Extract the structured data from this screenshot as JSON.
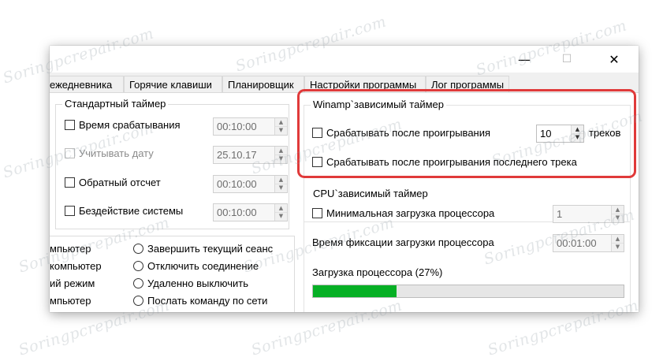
{
  "watermark": "Soringpcrepair.com",
  "window": {
    "minimize_glyph": "—",
    "maximize_glyph": "☐",
    "close_glyph": "✕"
  },
  "tabs": [
    {
      "label": "ежедневника"
    },
    {
      "label": "Горячие клавиши"
    },
    {
      "label": "Планировщик"
    },
    {
      "label": "Настройки программы"
    },
    {
      "label": "Лог программы"
    }
  ],
  "standard_timer": {
    "title": "Стандартный таймер",
    "rows": [
      {
        "label": "Время срабатывания",
        "value": "00:10:00",
        "checked": false,
        "enabled": true
      },
      {
        "label": "Учитывать дату",
        "value": "25.10.17",
        "checked": false,
        "enabled": false
      },
      {
        "label": "Обратный отсчет",
        "value": "00:10:00",
        "checked": false,
        "enabled": true
      },
      {
        "label": "Бездействие системы",
        "value": "00:10:00",
        "checked": false,
        "enabled": true
      }
    ]
  },
  "actions": {
    "left": [
      "мпьютер",
      "компьютер",
      "ий режим",
      "мпьютер"
    ],
    "right": [
      "Завершить текущий сеанс",
      "Отключить соединение",
      "Удаленно выключить",
      "Послать команду по сети"
    ]
  },
  "winamp_timer": {
    "title": "Winamp`зависимый таймер",
    "after_playing_label": "Срабатывать после проигрывания",
    "tracks_value": "10",
    "tracks_suffix": "треков",
    "after_last_track_label": "Срабатывать после проигрывания последнего трека"
  },
  "cpu_timer": {
    "title": "CPU`зависимый таймер",
    "min_load_label": "Минимальная загрузка процессора",
    "min_load_value": "1",
    "fix_time_label": "Время фиксации загрузки процессора",
    "fix_time_value": "00:01:00",
    "load_label": "Загрузка процессора (27%)",
    "load_fraction": 0.27
  },
  "colors": {
    "progress": "#06b025",
    "highlight": "#e03a3a"
  }
}
